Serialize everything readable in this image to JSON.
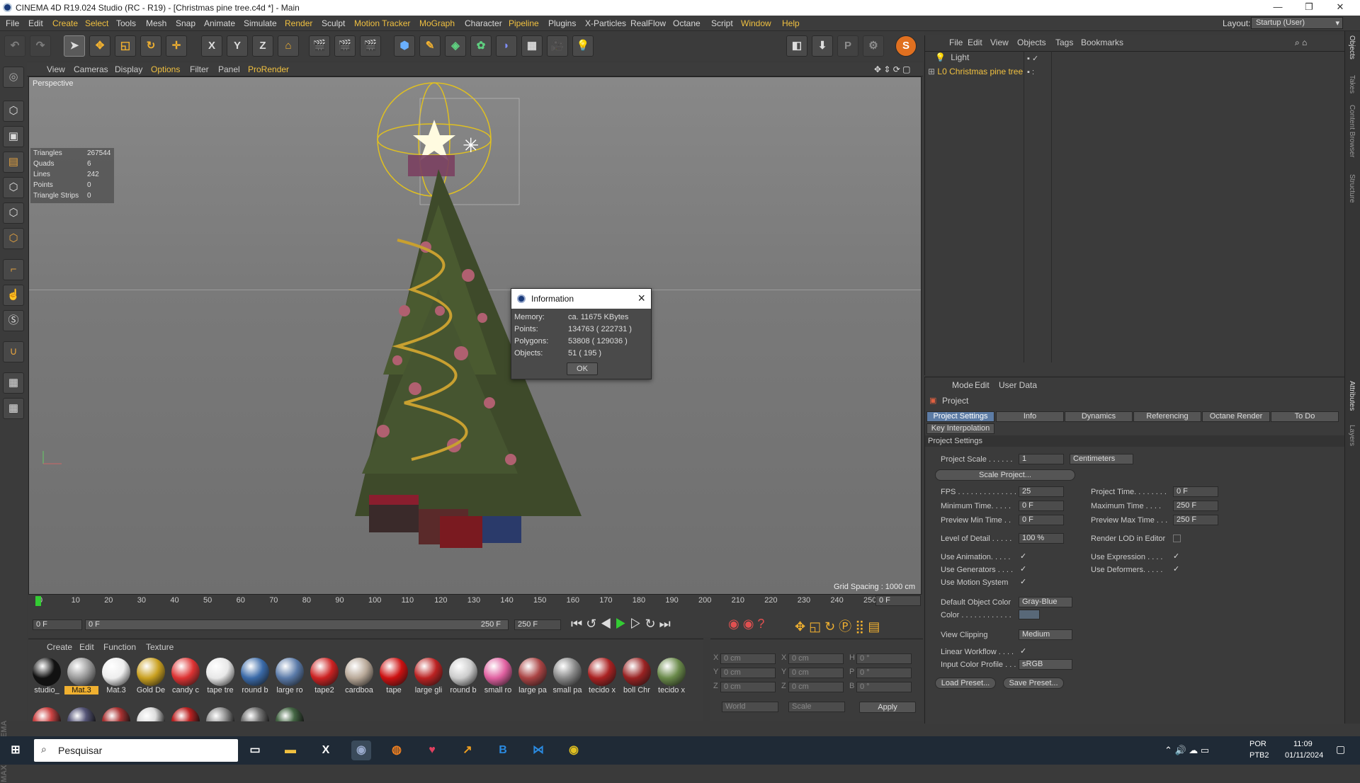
{
  "window": {
    "title": "CINEMA 4D R19.024 Studio (RC - R19) - [Christmas pine tree.c4d *] - Main"
  },
  "menu": [
    "File",
    "Edit",
    "Create",
    "Select",
    "Tools",
    "Mesh",
    "Snap",
    "Animate",
    "Simulate",
    "Render",
    "Sculpt",
    "Motion Tracker",
    "MoGraph",
    "Character",
    "Pipeline",
    "Plugins",
    "X-Particles",
    "RealFlow",
    "Octane",
    "Script",
    "Window",
    "Help"
  ],
  "layout": {
    "label": "Layout:",
    "value": "Startup (User)"
  },
  "toolbar": {
    "x": "X",
    "y": "Y",
    "z": "Z"
  },
  "viewport": {
    "menu": [
      "View",
      "Cameras",
      "Display",
      "Options",
      "Filter",
      "Panel",
      "ProRender"
    ],
    "label": "Perspective",
    "grid_spacing": "Grid Spacing : 1000 cm",
    "stats": [
      {
        "k": "Triangles",
        "v": "267544"
      },
      {
        "k": "Quads",
        "v": "6"
      },
      {
        "k": "Lines",
        "v": "242"
      },
      {
        "k": "Points",
        "v": "0"
      },
      {
        "k": "Triangle Strips",
        "v": "0"
      }
    ]
  },
  "dialog": {
    "title": "Information",
    "rows": [
      {
        "k": "Memory:",
        "v": "ca. 11675 KBytes"
      },
      {
        "k": "Points:",
        "v": "134763 ( 222731 )"
      },
      {
        "k": "Polygons:",
        "v": "53808 ( 129036 )"
      },
      {
        "k": "Objects:",
        "v": "51 ( 195 )"
      }
    ],
    "ok": "OK"
  },
  "timeline": {
    "ticks": [
      "0",
      "10",
      "20",
      "30",
      "40",
      "50",
      "60",
      "70",
      "80",
      "90",
      "100",
      "110",
      "120",
      "130",
      "140",
      "150",
      "160",
      "170",
      "180",
      "190",
      "200",
      "210",
      "220",
      "230",
      "240",
      "250"
    ],
    "current": "0 F",
    "start": "0 F",
    "range_start": "0 F",
    "range_end": "250 F",
    "end": "250 F",
    "frame_field": "0 F"
  },
  "materials": {
    "menu": [
      "Create",
      "Edit",
      "Function",
      "Texture"
    ],
    "items": [
      {
        "name": "studio_",
        "color": "#111"
      },
      {
        "name": "Mat.3",
        "color": "#999"
      },
      {
        "name": "Mat.3",
        "color": "#eee"
      },
      {
        "name": "Gold De",
        "color": "#c9a020"
      },
      {
        "name": "candy c",
        "color": "#d33"
      },
      {
        "name": "tape tre",
        "color": "#e8e8e8"
      },
      {
        "name": "round b",
        "color": "#3a6aa8"
      },
      {
        "name": "large ro",
        "color": "#5a7aa8"
      },
      {
        "name": "tape2",
        "color": "#c22"
      },
      {
        "name": "cardboa",
        "color": "#b8a898"
      },
      {
        "name": "tape",
        "color": "#c11"
      },
      {
        "name": "large gli",
        "color": "#b22"
      },
      {
        "name": "round b",
        "color": "#ccc"
      },
      {
        "name": "small ro",
        "color": "#e060a0"
      },
      {
        "name": "large pa",
        "color": "#a44"
      },
      {
        "name": "small pa",
        "color": "#888"
      },
      {
        "name": "tecido x",
        "color": "#a22"
      },
      {
        "name": "boll Chr",
        "color": "#922"
      },
      {
        "name": "tecido x",
        "color": "#6a8a4a"
      }
    ],
    "row2": [
      "#c44",
      "#557",
      "#a33",
      "#ddd",
      "#b22",
      "#999",
      "#777",
      "#464"
    ]
  },
  "coords": {
    "rows": [
      {
        "a": "X",
        "av": "0 cm",
        "b": "X",
        "bv": "0 cm",
        "c": "H",
        "cv": "0 °"
      },
      {
        "a": "Y",
        "av": "0 cm",
        "b": "Y",
        "bv": "0 cm",
        "c": "P",
        "cv": "0 °"
      },
      {
        "a": "Z",
        "av": "0 cm",
        "b": "Z",
        "bv": "0 cm",
        "c": "B",
        "cv": "0 °"
      }
    ],
    "world": "World",
    "scale": "Scale",
    "apply": "Apply"
  },
  "objects": {
    "menu": [
      "File",
      "Edit",
      "View",
      "Objects",
      "Tags",
      "Bookmarks"
    ],
    "items": [
      {
        "name": "Light",
        "color": "#ddd"
      },
      {
        "name": "Christmas pine tree",
        "color": "#f0c040"
      }
    ]
  },
  "attributes": {
    "menu": [
      "Mode",
      "Edit",
      "User Data"
    ],
    "header": "Project",
    "tabs": [
      "Project Settings",
      "Info",
      "Dynamics",
      "Referencing",
      "Octane Render",
      "To Do"
    ],
    "tab2": "Key Interpolation",
    "section": "Project Settings",
    "project_scale": {
      "label": "Project Scale . . . . . .",
      "value": "1",
      "unit": "Centimeters"
    },
    "scale_btn": "Scale Project...",
    "fps": {
      "label": "FPS . . . . . . . . . . . . . . .",
      "value": "25"
    },
    "project_time": {
      "label": "Project Time. . . . . . . .",
      "value": "0 F"
    },
    "min_time": {
      "label": "Minimum Time. . . . .",
      "value": "0 F"
    },
    "max_time": {
      "label": "Maximum Time . . . .",
      "value": "250 F"
    },
    "prev_min": {
      "label": "Preview Min Time . .",
      "value": "0 F"
    },
    "prev_max": {
      "label": "Preview Max Time . . .",
      "value": "250 F"
    },
    "lod": {
      "label": "Level of Detail . . . . .",
      "value": "100 %"
    },
    "render_lod": "Render LOD in Editor",
    "use_anim": "Use Animation. . . . .",
    "use_expr": "Use Expression . . . .",
    "use_gen": "Use Generators . . . .",
    "use_def": "Use Deformers. . . . .",
    "use_motion": "Use Motion System",
    "def_obj_color": {
      "label": "Default Object Color",
      "value": "Gray-Blue"
    },
    "color": "Color . . . . . . . . . . . .",
    "view_clip": {
      "label": "View Clipping",
      "value": "Medium"
    },
    "linear": "Linear Workflow . . . .",
    "input_color": {
      "label": "Input Color Profile . . .",
      "value": "sRGB"
    },
    "load": "Load Preset...",
    "save": "Save Preset..."
  },
  "sidebar": [
    "Objects",
    "Takes",
    "Content Browser",
    "Structure",
    "Attributes",
    "Layers"
  ],
  "taskbar": {
    "search": "Pesquisar",
    "lang1": "POR",
    "lang2": "PTB2",
    "time": "11:09",
    "date": "01/11/2024"
  }
}
